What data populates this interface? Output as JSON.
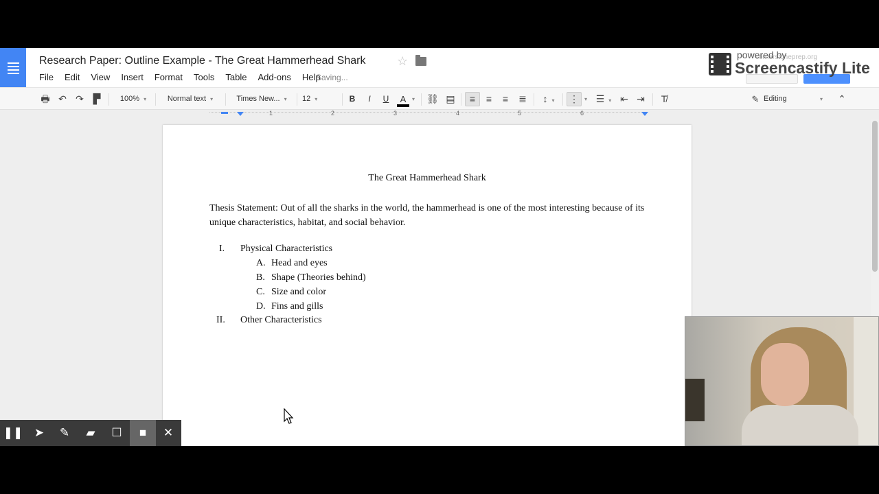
{
  "document": {
    "title": "Research Paper: Outline Example - The Great Hammerhead Shark",
    "status": "Saving...",
    "heading": "The Great Hammerhead Shark",
    "thesis": "Thesis Statement: Out of all the sharks in the world, the hammerhead is one of the most interesting because of its unique characteristics, habitat, and social behavior.",
    "outline": [
      {
        "marker": "I.",
        "text": "Physical Characteristics",
        "level": 1
      },
      {
        "marker": "A.",
        "text": "Head and eyes",
        "level": 2
      },
      {
        "marker": "B.",
        "text": "Shape (Theories behind)",
        "level": 2
      },
      {
        "marker": "C.",
        "text": "Size and color",
        "level": 2
      },
      {
        "marker": "D.",
        "text": "Fins and gills",
        "level": 2
      },
      {
        "marker": "II.",
        "text": "Other Characteristics",
        "level": 1
      }
    ]
  },
  "menu": [
    "File",
    "Edit",
    "View",
    "Insert",
    "Format",
    "Tools",
    "Table",
    "Add-ons",
    "Help"
  ],
  "toolbar": {
    "zoom": "100%",
    "style": "Normal text",
    "font": "Times New...",
    "size": "12",
    "mode": "Editing",
    "bold": "B",
    "italic": "I",
    "underline": "U",
    "text_color": "A"
  },
  "ruler": [
    "1",
    "2",
    "3",
    "4",
    "5",
    "6"
  ],
  "watermark": {
    "powered": "powered by",
    "brand": "Screencastify Lite"
  },
  "account": "cornerstoneprep.org",
  "colors": {
    "accent": "#4285f4",
    "share": "#4d90fe",
    "controls_bg": "#3a3a3a"
  },
  "controls": [
    "pause-icon",
    "pointer-icon",
    "pen-icon",
    "eraser-icon",
    "rectangle-icon",
    "camera-icon",
    "close-icon"
  ]
}
